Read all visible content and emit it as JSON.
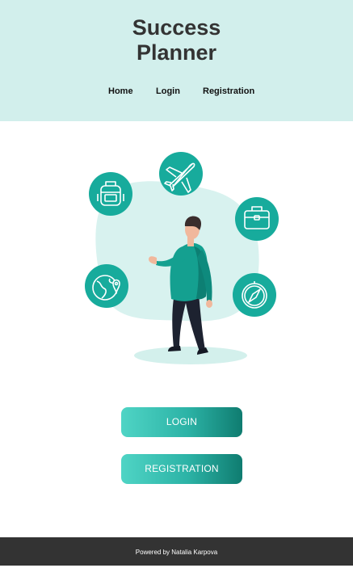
{
  "header": {
    "title": "Success\nPlanner",
    "nav": [
      {
        "label": "Home"
      },
      {
        "label": "Login"
      },
      {
        "label": "Registration"
      }
    ]
  },
  "illustration": {
    "icons": [
      "backpack-icon",
      "airplane-icon",
      "briefcase-icon",
      "globe-location-icon",
      "compass-icon"
    ],
    "accent_color": "#17ab9c",
    "blob_color": "#d8f2ef"
  },
  "buttons": {
    "login_label": "LOGIN",
    "registration_label": "REGISTRATION"
  },
  "footer": {
    "text": "Powered by Natalia Karpova"
  }
}
